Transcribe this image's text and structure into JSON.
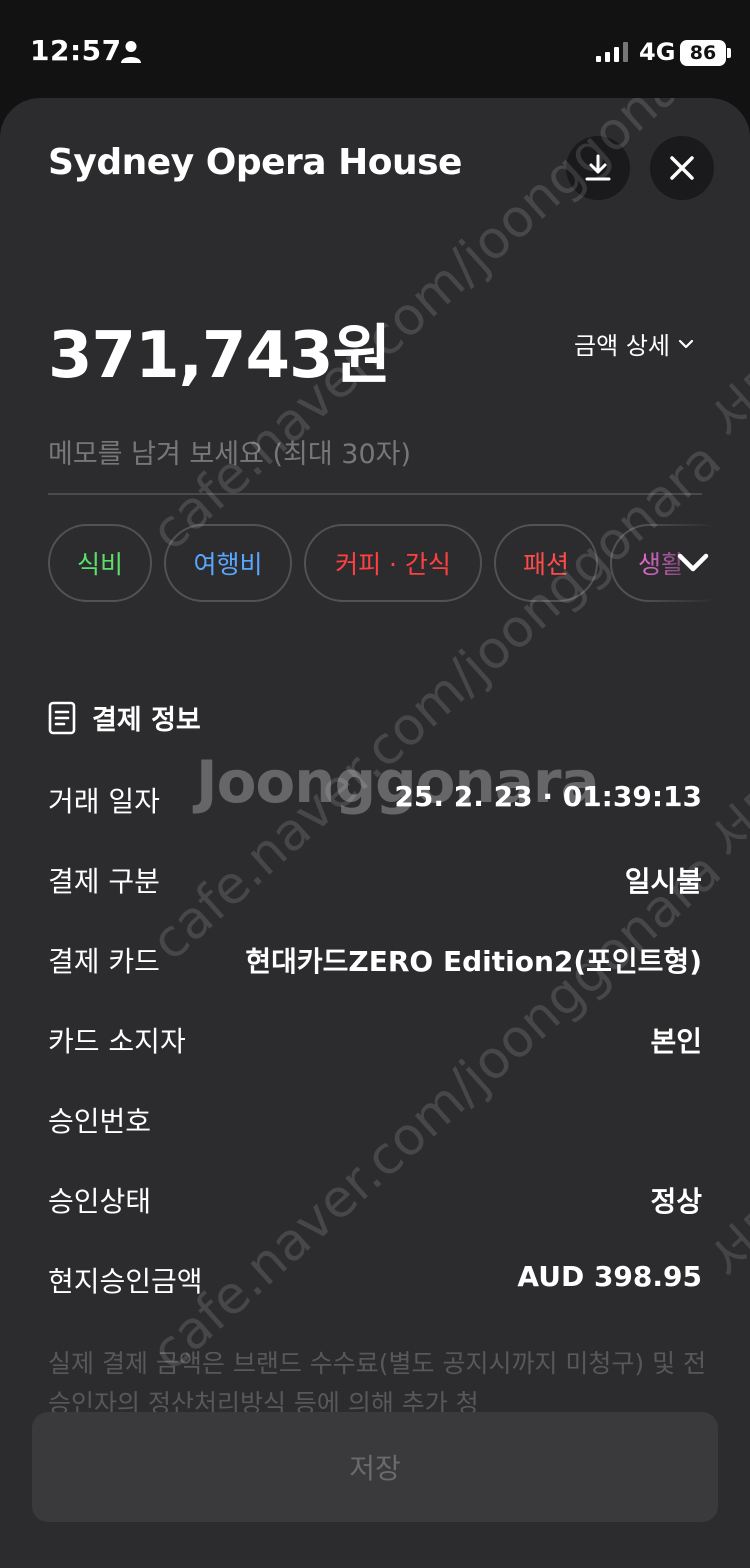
{
  "status_bar": {
    "time": "12:57",
    "network": "4G",
    "battery": "86"
  },
  "header": {
    "title": "Sydney Opera House",
    "download_icon": "download-icon",
    "close_icon": "close-icon"
  },
  "amount": {
    "value": "371,743원",
    "detail_label": "금액 상세"
  },
  "memo": {
    "placeholder": "메모를 남겨 보세요 (최대 30자)"
  },
  "categories": [
    {
      "label": "식비",
      "color": "#5ce06a"
    },
    {
      "label": "여행비",
      "color": "#5aa6ff"
    },
    {
      "label": "커피 · 간식",
      "color": "#ff4040"
    },
    {
      "label": "패션",
      "color": "#ff4a4a"
    },
    {
      "label": "생활",
      "color": "#e46bd0"
    }
  ],
  "payment_info": {
    "section_title": "결제 정보",
    "rows": [
      {
        "label": "거래 일자",
        "value": "25. 2. 23 · 01:39:13"
      },
      {
        "label": "결제 구분",
        "value": "일시불"
      },
      {
        "label": "결제 카드",
        "value": "현대카드ZERO Edition2(포인트형)"
      },
      {
        "label": "카드 소지자",
        "value": "본인"
      },
      {
        "label": "승인번호",
        "value": ""
      },
      {
        "label": "승인상태",
        "value": "정상"
      },
      {
        "label": "현지승인금액",
        "value": "AUD 398.95"
      }
    ]
  },
  "notice": "실제 결제 금액은 브랜드 수수료(별도 공지시까지 미청구) 및 전승인자의 정산처리방식 등에 의해 추가 청",
  "save_button": "저장",
  "watermarks": {
    "main": "Joonggonara",
    "diagonal": "cafe.naver.com/joonggonara",
    "side": "서마나"
  }
}
